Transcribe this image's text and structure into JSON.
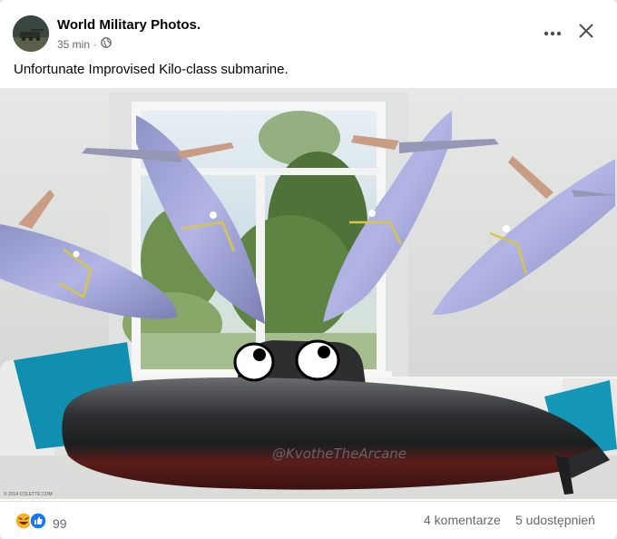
{
  "post": {
    "author": "World Military Photos.",
    "time": "35 min",
    "separator": "·",
    "caption": "Unfortunate Improvised Kilo-class submarine."
  },
  "photo": {
    "watermark": "@KvotheTheArcane",
    "copyright": "© 2014 COLETTE.COM"
  },
  "footer": {
    "reaction_count": "99",
    "comments": "4 komentarze",
    "shares": "5 udostępnień"
  },
  "icons": {
    "privacy": "globe-icon",
    "more": "more-horizontal-icon",
    "close": "close-icon",
    "reactions": [
      "haha-reaction-icon",
      "like-reaction-icon"
    ]
  },
  "colors": {
    "like_blue": "#1877f2",
    "haha_yellow": "#f7b125",
    "meta_gray": "#65676b"
  }
}
